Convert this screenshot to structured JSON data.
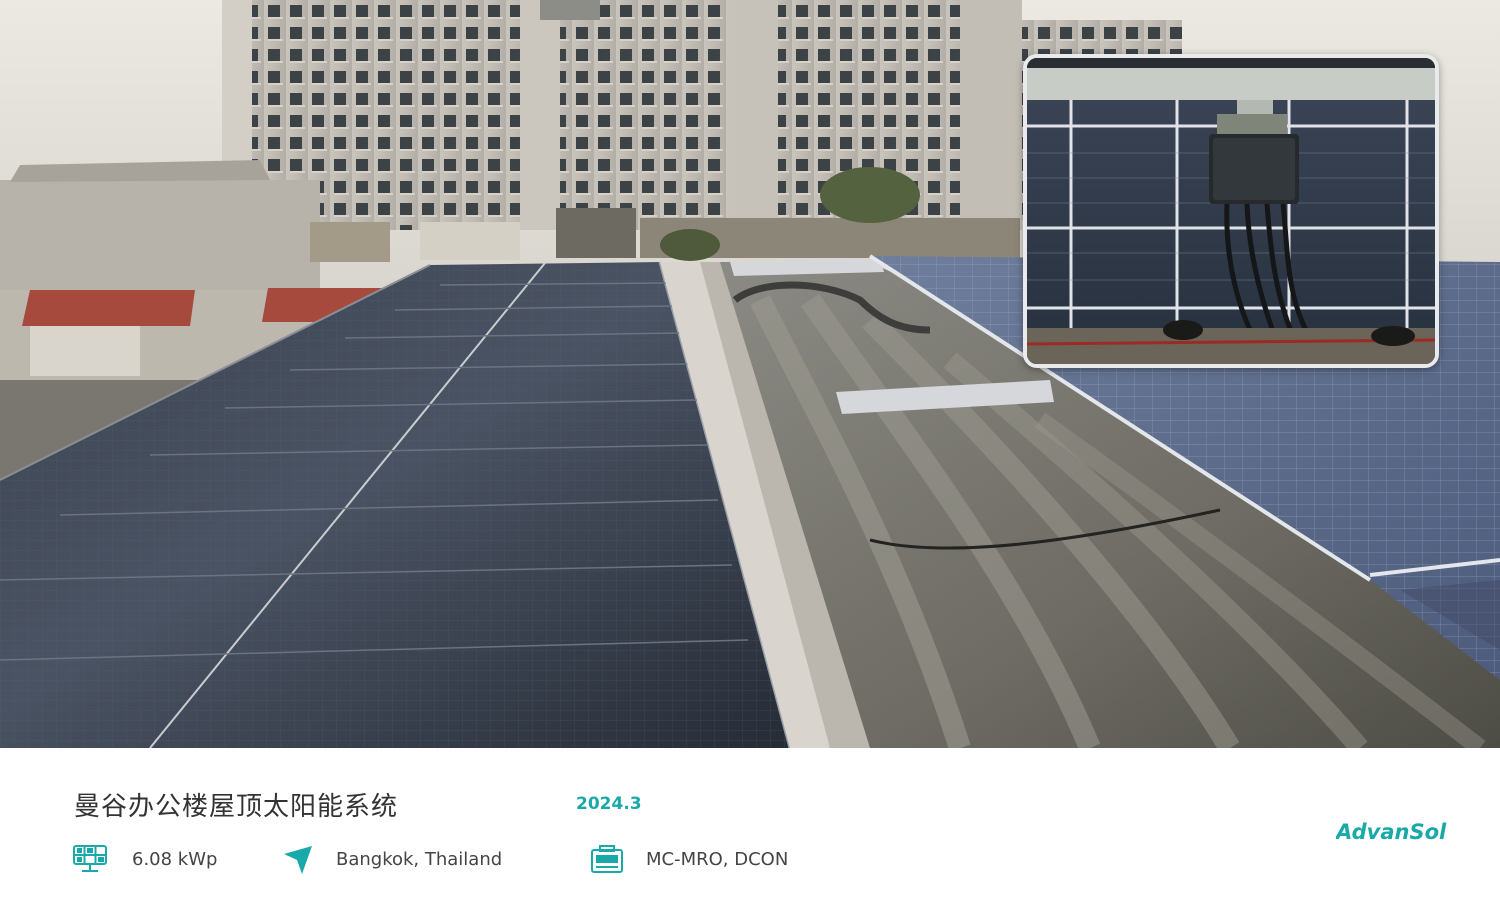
{
  "project": {
    "title": "曼谷办公楼屋顶太阳能系统",
    "date": "2024.3"
  },
  "specs": {
    "power": {
      "icon": "solar-panel-icon",
      "value": "6.08 kWp"
    },
    "location": {
      "icon": "location-arrow-icon",
      "value": "Bangkok, Thailand"
    },
    "products": {
      "icon": "device-box-icon",
      "value": "MC-MRO, DCON"
    }
  },
  "brand": {
    "name": "AdvanSol",
    "color": "#1aa9a9"
  },
  "colors": {
    "accent": "#1aa9a9",
    "text": "#444444"
  }
}
